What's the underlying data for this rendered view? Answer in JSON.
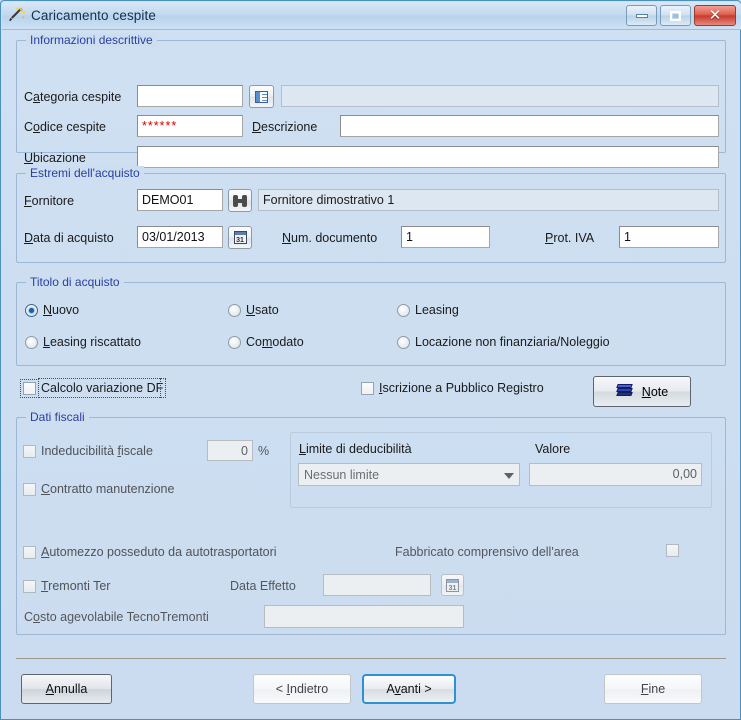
{
  "window": {
    "title": "Caricamento cespite",
    "icon": "wizard-wand-icon",
    "minimize_label": "",
    "maximize_label": "",
    "close_label": "✕",
    "frame_color": "#4a90b8",
    "body_color": "#cddef1"
  },
  "groups": {
    "descriptive": {
      "legend": "Informazioni descrittive"
    },
    "purchase": {
      "legend": "Estremi dell'acquisto"
    },
    "title_of_purchase": {
      "legend": "Titolo di acquisto"
    },
    "fiscal": {
      "legend": "Dati fiscali"
    }
  },
  "descriptive": {
    "categoria_label_pre": "C",
    "categoria_label_acc": "a",
    "categoria_label_post": "tegoria cespite",
    "categoria_value": "",
    "categoria_desc_value": "",
    "lookup_icon": "list-icon",
    "codice_label_pre": "C",
    "codice_label_acc": "o",
    "codice_label_post": "dice cespite",
    "codice_value": "******",
    "descrizione_label_pre": "",
    "descrizione_label_acc": "D",
    "descrizione_label_post": "escrizione",
    "descrizione_value": "",
    "ubicazione_label_pre": "",
    "ubicazione_label_acc": "U",
    "ubicazione_label_post": "bicazione",
    "ubicazione_value": ""
  },
  "purchase": {
    "fornitore_label_pre": "",
    "fornitore_label_acc": "F",
    "fornitore_label_post": "ornitore",
    "fornitore_value": "DEMO01",
    "fornitore_search_icon": "binoculars-icon",
    "fornitore_desc_value": "Fornitore dimostrativo 1",
    "data_label_pre": "",
    "data_label_acc": "D",
    "data_label_post": "ata di acquisto",
    "data_value": "03/01/2013",
    "data_calendar_icon": "calendar-icon",
    "calendar_glyph": "31",
    "num_doc_label_pre": "",
    "num_doc_label_acc": "N",
    "num_doc_label_post": "um. documento",
    "num_doc_value": "1",
    "prot_iva_label_pre": "",
    "prot_iva_label_acc": "P",
    "prot_iva_label_post": "rot. IVA",
    "prot_iva_value": "1"
  },
  "title_of_purchase": {
    "options": [
      {
        "pre": "",
        "acc": "N",
        "post": "uovo",
        "selected": true
      },
      {
        "pre": "",
        "acc": "U",
        "post": "sato",
        "selected": false
      },
      {
        "pre": "Leasin",
        "acc": "g",
        "post": "",
        "selected": false
      },
      {
        "pre": "",
        "acc": "L",
        "post": "easing riscattato",
        "selected": false
      },
      {
        "pre": "Co",
        "acc": "m",
        "post": "odato",
        "selected": false
      },
      {
        "pre": "Locazione non finanziaria/Noleggio",
        "acc": "",
        "post": "",
        "selected": false
      }
    ]
  },
  "flags": {
    "calcolo_variazione_pre": "Calcolo variazione DF",
    "calcolo_variazione_acc": "",
    "calcolo_variazione_post": "",
    "calcolo_variazione_checked": false,
    "iscrizione_pre": "",
    "iscrizione_acc": "I",
    "iscrizione_post": "scrizione a Pubblico Registro",
    "iscrizione_checked": false,
    "note_button_pre": "",
    "note_button_acc": "N",
    "note_button_post": "ote",
    "note_icon": "books-stack-icon"
  },
  "fiscal": {
    "indeducibilita_pre": "Indeducibilità ",
    "indeducibilita_acc": "f",
    "indeducibilita_post": "iscale",
    "indeducibilita_checked": false,
    "perc_value": "0",
    "perc_suffix": "%",
    "limite_label_pre": "",
    "limite_label_acc": "L",
    "limite_label_post": "imite di deducibilità",
    "limite_value": "Nessun limite",
    "limite_options": [
      "Nessun limite"
    ],
    "valore_label": "Valore",
    "valore_value": "0,00",
    "contratto_pre": "",
    "contratto_acc": "C",
    "contratto_post": "ontratto manutenzione",
    "contratto_checked": false,
    "automezzo_pre": "",
    "automezzo_acc": "A",
    "automezzo_post": "utomezzo posseduto da autotrasportatori",
    "automezzo_checked": false,
    "fabbricato_label": "Fabbricato comprensivo dell'area",
    "fabbricato_checked": false,
    "tremonti_pre": "",
    "tremonti_acc": "T",
    "tremonti_post": "remonti Ter",
    "tremonti_checked": false,
    "data_effetto_label": "Data Effetto",
    "data_effetto_value": "",
    "data_effetto_icon": "calendar-icon",
    "costo_label_pre": "C",
    "costo_label_acc": "o",
    "costo_label_post": "sto agevolabile TecnoTremonti",
    "costo_value": ""
  },
  "footer": {
    "annulla_pre": "",
    "annulla_acc": "A",
    "annulla_post": "nnulla",
    "indietro_pre": "< ",
    "indietro_acc": "I",
    "indietro_post": "ndietro",
    "avanti_pre": "A",
    "avanti_acc": "v",
    "avanti_post": "anti >",
    "fine_pre": "",
    "fine_acc": "F",
    "fine_post": "ine"
  }
}
